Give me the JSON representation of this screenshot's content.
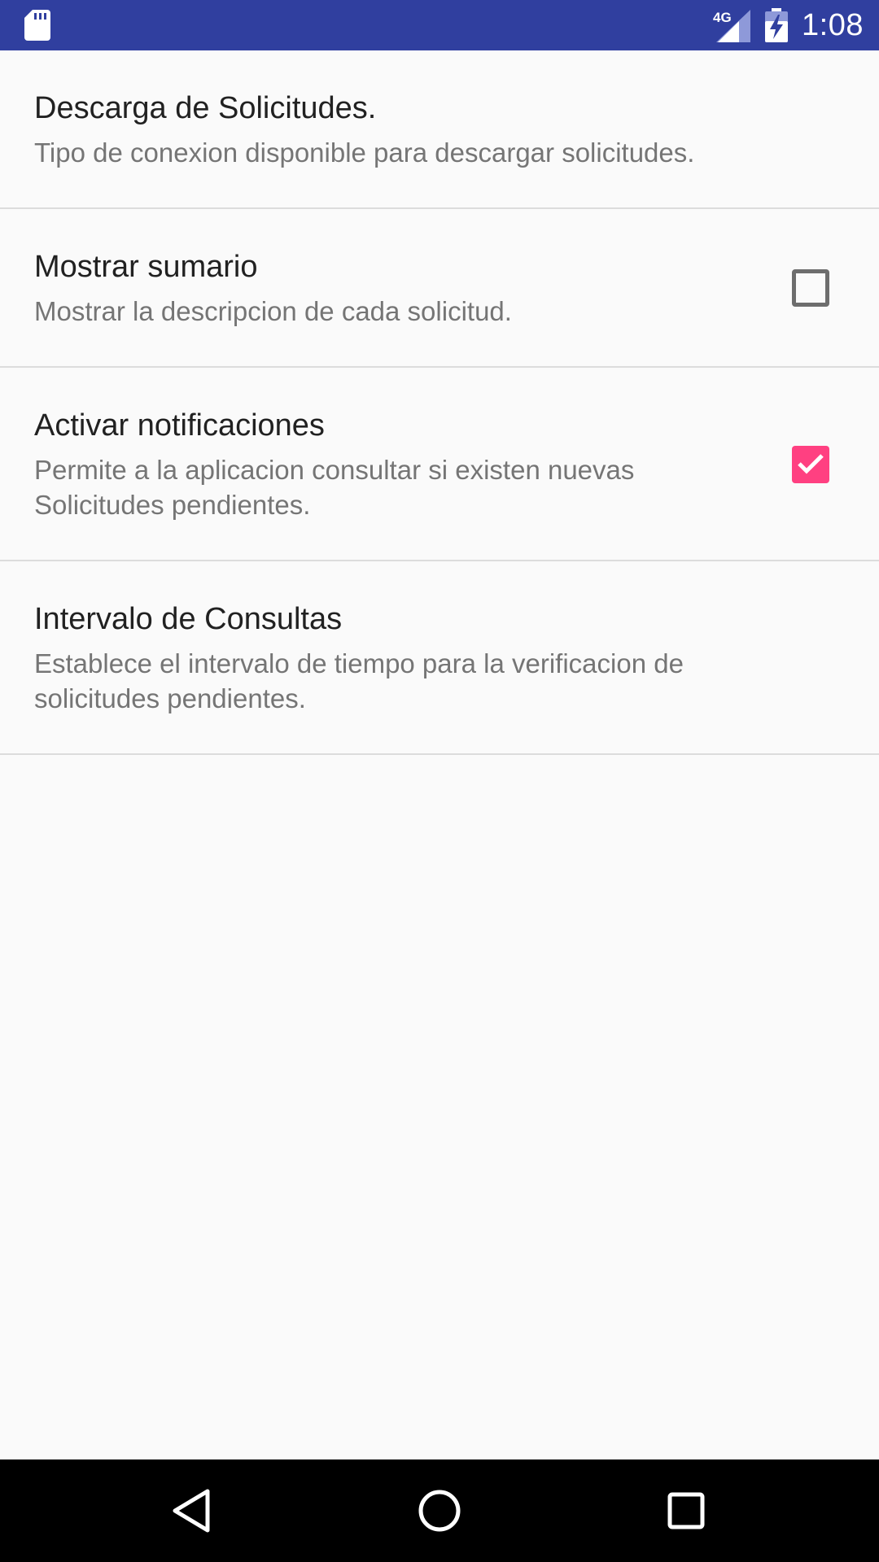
{
  "status_bar": {
    "network_type": "4G",
    "time": "1:08",
    "icons": [
      "sd-card-icon",
      "signal-icon",
      "battery-charging-icon"
    ]
  },
  "preferences": [
    {
      "title": "Descarga de Solicitudes.",
      "summary": "Tipo de conexion disponible para descargar solicitudes.",
      "has_checkbox": false
    },
    {
      "title": "Mostrar sumario",
      "summary": "Mostrar la descripcion de cada solicitud.",
      "has_checkbox": true,
      "checked": false
    },
    {
      "title": "Activar notificaciones",
      "summary": "Permite a la aplicacion consultar si existen nuevas Solicitudes pendientes.",
      "has_checkbox": true,
      "checked": true
    },
    {
      "title": "Intervalo de Consultas",
      "summary": "Establece el intervalo de tiempo para la verificacion de solicitudes pendientes.",
      "has_checkbox": false
    }
  ],
  "nav_bar": {
    "icons": [
      "back-icon",
      "home-icon",
      "recents-icon"
    ]
  },
  "colors": {
    "status_bar": "#303f9f",
    "accent": "#ff4081",
    "background": "#fafafa",
    "title_text": "#212121",
    "summary_text": "#757575"
  }
}
